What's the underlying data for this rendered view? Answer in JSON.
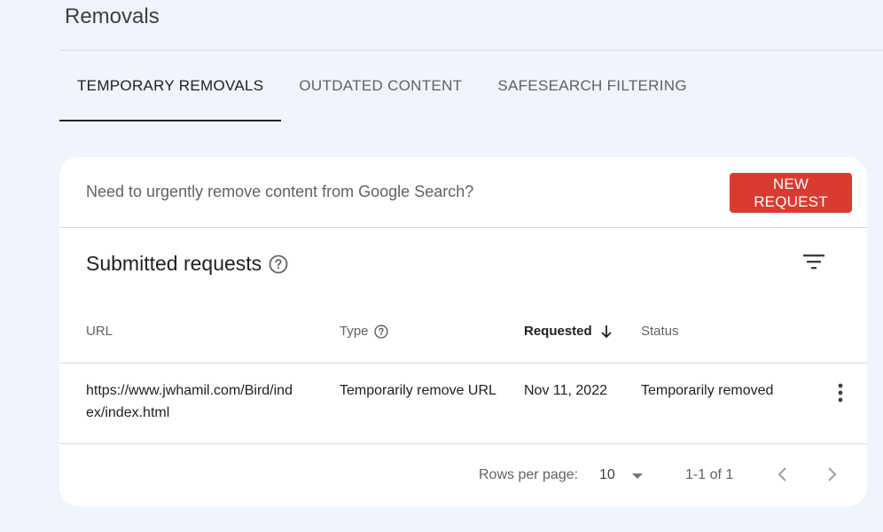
{
  "page": {
    "title": "Removals"
  },
  "tabs": [
    {
      "label": "TEMPORARY REMOVALS",
      "active": true
    },
    {
      "label": "OUTDATED CONTENT",
      "active": false
    },
    {
      "label": "SAFESEARCH FILTERING",
      "active": false
    }
  ],
  "banner": {
    "text": "Need to urgently remove content from Google Search?",
    "button_label": "NEW REQUEST"
  },
  "requests": {
    "title": "Submitted requests",
    "columns": {
      "url": "URL",
      "type": "Type",
      "requested": "Requested",
      "status": "Status"
    },
    "rows": [
      {
        "url_line1": "https://www.jwhamil.com/Bird/ind",
        "url_line2": "ex/index.html",
        "type": "Temporarily remove URL",
        "requested": "Nov 11, 2022",
        "status": "Temporarily removed"
      }
    ]
  },
  "pagination": {
    "rows_per_page_label": "Rows per page:",
    "rows_per_page": "10",
    "range": "1-1 of 1"
  },
  "colors": {
    "background": "#f0f4fc",
    "accent_button": "#d93b30",
    "active_tab": "#202124"
  },
  "icons": [
    "help-icon",
    "filter-icon",
    "sort-arrow-down-icon",
    "more-vert-icon",
    "dropdown-arrow-icon",
    "chevron-left-icon",
    "chevron-right-icon"
  ]
}
